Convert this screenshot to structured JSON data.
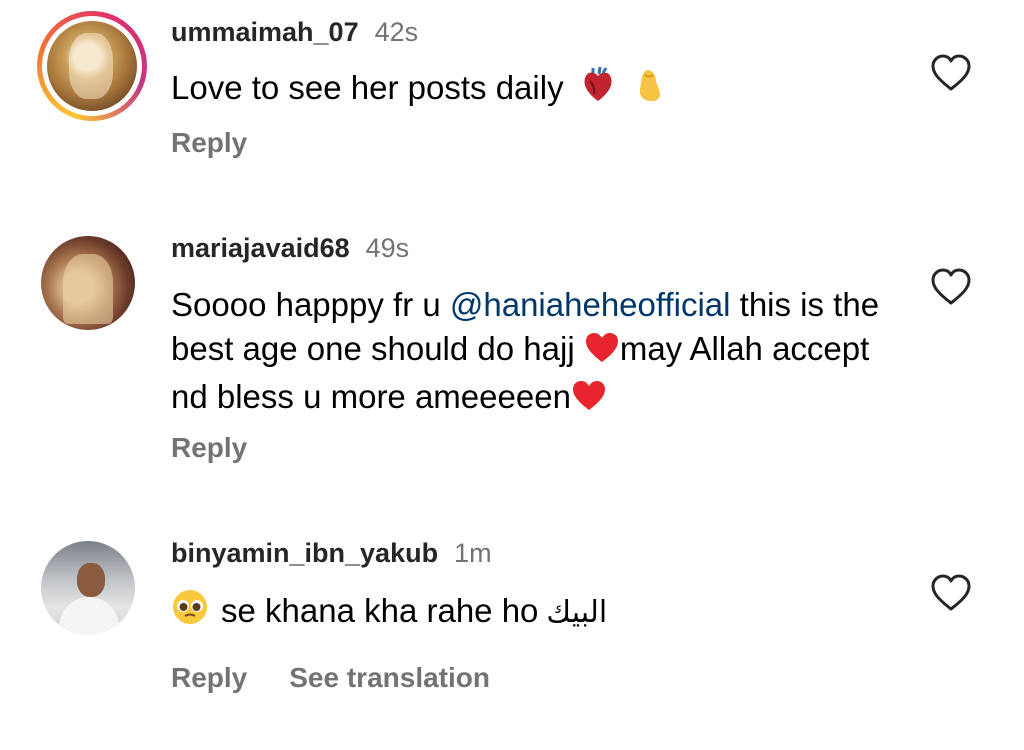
{
  "comments": [
    {
      "username": "ummaimah_07",
      "time": "42s",
      "text": "Love to see her posts daily",
      "emojis": [
        "anatomical-heart",
        "pinched-fingers"
      ],
      "reply": "Reply",
      "story_ring": true
    },
    {
      "username": "mariajavaid68",
      "time": "49s",
      "text_parts": {
        "a": "Soooo happpy fr u ",
        "mention": "@haniaheheofficial",
        "b": " this is the best age one should do hajj ",
        "c": "may Allah accept nd bless u more ameeeeen"
      },
      "emojis": [
        "red-heart",
        "red-heart"
      ],
      "reply": "Reply"
    },
    {
      "username": "binyamin_ibn_yakub",
      "time": "1m",
      "text": "se khana kha rahe ho",
      "arabic": "البيك",
      "emojis": [
        "pleading-face"
      ],
      "reply": "Reply",
      "translate": "See translation"
    }
  ],
  "colors": {
    "secondary_text": "#737373",
    "mention": "#00376b",
    "heart": "#e0245e"
  }
}
